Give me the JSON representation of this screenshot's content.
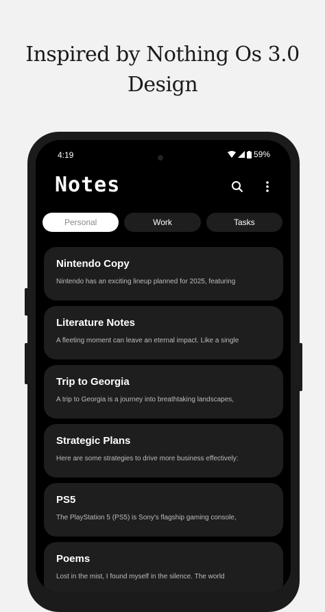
{
  "headline": {
    "line1": "Inspired by Nothing Os 3.0",
    "line2": "Design"
  },
  "status": {
    "time": "4:19",
    "battery": "59%"
  },
  "app": {
    "title": "Notes"
  },
  "tabs": [
    {
      "label": "Personal",
      "active": true
    },
    {
      "label": "Work",
      "active": false
    },
    {
      "label": "Tasks",
      "active": false
    }
  ],
  "notes": [
    {
      "title": "Nintendo Copy",
      "body": "Nintendo has an exciting lineup planned for 2025, featuring"
    },
    {
      "title": "Literature Notes",
      "body": "A fleeting moment can leave an eternal impact. Like a single"
    },
    {
      "title": "Trip to Georgia",
      "body": "A trip to Georgia is a journey into breathtaking landscapes,"
    },
    {
      "title": "Strategic Plans",
      "body": "Here are some strategies to drive more business effectively:"
    },
    {
      "title": "PS5",
      "body": "The PlayStation 5 (PS5) is Sony's flagship gaming console,"
    },
    {
      "title": "Poems",
      "body": "Lost in the mist, I found myself in the silence. The world"
    }
  ],
  "icons": {
    "search": "search-icon",
    "menu": "more-vertical-icon"
  },
  "colors": {
    "background": "#f2f2f2",
    "phone": "#1b1b1b",
    "screen": "#000000",
    "card": "#1e1e1e",
    "active_tab": "#ffffff"
  }
}
